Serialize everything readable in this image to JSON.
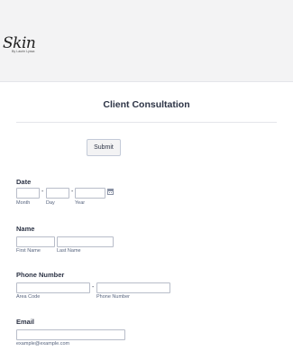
{
  "header": {
    "logo_script": "Skin",
    "logo_sub": "By Laurin Lyssa"
  },
  "form": {
    "title": "Client Consultation",
    "submit_label": "Submit",
    "date": {
      "label": "Date",
      "month_label": "Month",
      "day_label": "Day",
      "year_label": "Year",
      "separator": "-",
      "calendar_icon": "calendar-icon"
    },
    "name": {
      "label": "Name",
      "first_label": "First Name",
      "last_label": "Last Name"
    },
    "phone": {
      "label": "Phone Number",
      "area_label": "Area Code",
      "number_label": "Phone Number",
      "separator": "-"
    },
    "email": {
      "label": "Email",
      "hint": "example@example.com"
    }
  }
}
